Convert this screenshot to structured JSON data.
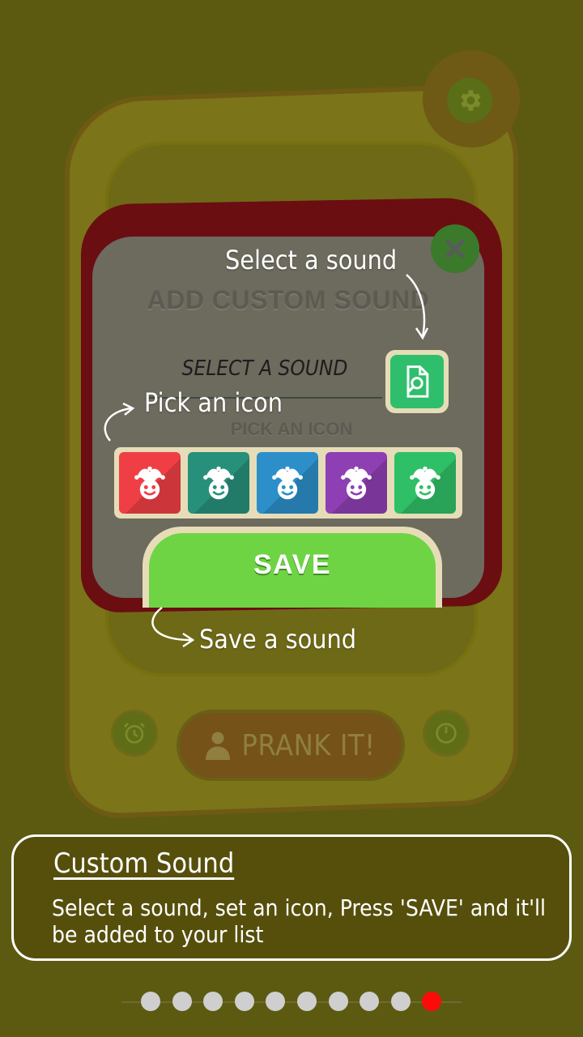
{
  "background_app": {
    "prank_button_label": "PRANK IT!",
    "settings_icon": "gear-icon",
    "alarm_icon": "alarm-clock-icon",
    "timer_icon": "timer-icon"
  },
  "dialog": {
    "title": "ADD CUSTOM SOUND",
    "select_sound_label": "SELECT A SOUND",
    "select_sound_button_icon": "file-search-icon",
    "pick_icon_label": "PICK AN ICON",
    "icon_options": [
      {
        "name": "jester-red",
        "color": "#ef3f45"
      },
      {
        "name": "jester-teal",
        "color": "#27907a"
      },
      {
        "name": "jester-blue",
        "color": "#2c8fc9"
      },
      {
        "name": "jester-purple",
        "color": "#8e3fb3"
      },
      {
        "name": "jester-green",
        "color": "#2fbf66"
      }
    ],
    "save_label": "SAVE",
    "close_icon": "close-icon"
  },
  "annotations": {
    "select_sound": "Select a sound",
    "pick_icon": "Pick an icon",
    "save_sound": "Save a sound"
  },
  "info_card": {
    "title": "Custom Sound",
    "text": "Select a sound, set an icon, Press 'SAVE' and it'll be added to your list"
  },
  "pager": {
    "count": 10,
    "active_index": 9,
    "active_color": "#ff0a0a",
    "inactive_color": "#cfcfcf"
  }
}
